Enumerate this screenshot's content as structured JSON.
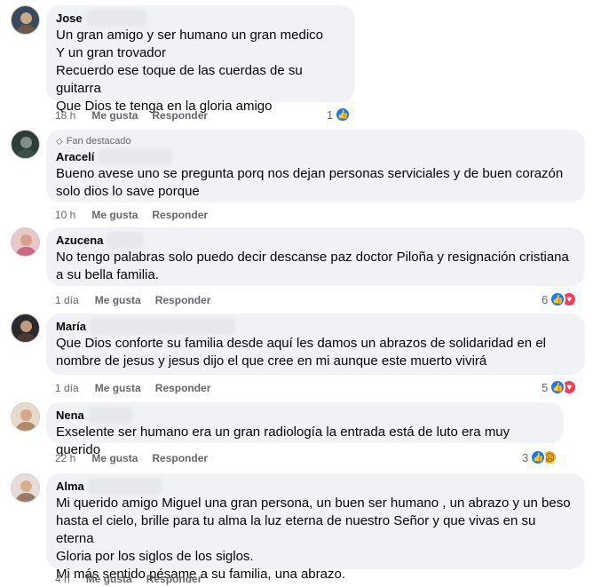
{
  "comments": [
    {
      "author": "Jose",
      "lines": "Un gran amigo y ser humano un gran medico\nY un gran trovador\nRecuerdo ese toque de las cuerdas de su guitarra\nQue Dios te tenga en la gloria amigo",
      "time": "18 h",
      "like": "Me gusta",
      "reply": "Responder",
      "reaction_count": "1"
    },
    {
      "badge": "Fan destacado",
      "author": "Aracelí",
      "lines": "Bueno avese uno se pregunta porq nos dejan personas serviciales y de buen corazón\nsolo dios lo save porque",
      "time": "10 h",
      "like": "Me gusta",
      "reply": "Responder"
    },
    {
      "author": "Azucena",
      "lines": "No tengo palabras solo puedo decir descanse paz doctor Piloña y resignación cristiana\na su bella familia.",
      "time": "1 día",
      "like": "Me gusta",
      "reply": "Responder",
      "reaction_count": "6"
    },
    {
      "author": "María",
      "lines": "Que Dios conforte su familia desde aquí les damos un abrazos de solidaridad en el\nnombre de jesus y jesus dijo el que cree en mi aunque este muerto vivirá",
      "time": "1 día",
      "like": "Me gusta",
      "reply": "Responder",
      "reaction_count": "5"
    },
    {
      "author": "Nena",
      "lines": "Exselente ser humano era un gran radiología la entrada está de luto era muy querido",
      "time": "22 h",
      "like": "Me gusta",
      "reply": "Responder",
      "reaction_count": "3"
    },
    {
      "author": "Alma",
      "lines": "Mi querido amigo Miguel una gran persona, un buen ser humano , un abrazo y un beso\nhasta el cielo, brille para tu alma la luz eterna de nuestro Señor y que vivas en su eterna\nGloria por los siglos de los siglos.\nMi más sentido pésame a su familia, una abrazo.",
      "time": "4 h",
      "like": "Me gusta",
      "reply": "Responder"
    }
  ],
  "icons": {
    "like_reaction": "thumbs-up-icon",
    "love_reaction": "heart-icon",
    "sad_reaction": "sad-face-icon",
    "badge": "diamond-icon"
  },
  "colors": {
    "like": "#1877f2",
    "love": "#f33e58",
    "sad": "#f7b125",
    "bubble": "#f0f2f5"
  }
}
